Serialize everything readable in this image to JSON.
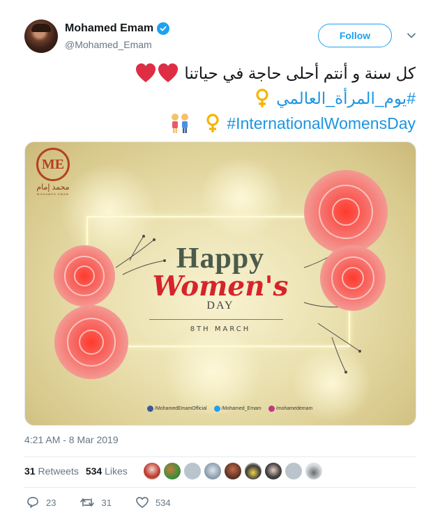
{
  "author": {
    "name": "Mohamed Emam",
    "handle": "@Mohamed_Emam",
    "verified": true
  },
  "follow_label": "Follow",
  "tweet": {
    "line1": "كل سنة و أنتم أحلى حاجة في حياتنا",
    "line2": "#يوم_المرأة_العالمي",
    "line3": "#InternationalWomensDay"
  },
  "image": {
    "happy": "Happy",
    "womens": "Women's",
    "day": "DAY",
    "date": "8TH MARCH",
    "logo_letters": "ME",
    "logo_arabic": "محمد إمام",
    "logo_sub": "MOHAMED EMAM",
    "social": [
      "/MohamedEmamOfficial",
      "/Mohamed_Emam",
      "/mohamedemam"
    ]
  },
  "timestamp": "4:21 AM - 8 Mar 2019",
  "stats": {
    "retweets_count": "31",
    "retweets_label": "Retweets",
    "likes_count": "534",
    "likes_label": "Likes"
  },
  "actions": {
    "replies": "23",
    "retweets": "31",
    "likes": "534"
  },
  "colors": {
    "accent": "#1da1f2",
    "hashtag": "#1b95e0",
    "muted": "#657786"
  }
}
